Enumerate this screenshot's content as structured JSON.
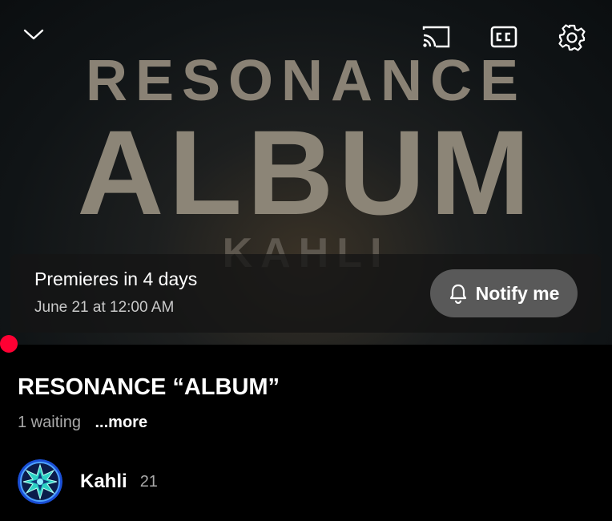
{
  "player": {
    "art_line1": "RESONANCE",
    "art_line2": "ALBUM",
    "art_line3": "KAHLI",
    "controls": [
      "chevron-down-icon",
      "cast-icon",
      "closed-captions-icon",
      "settings-gear-icon"
    ]
  },
  "premiere": {
    "title": "Premieres in 4 days",
    "date": "June 21 at 12:00 AM",
    "notify_label": "Notify me"
  },
  "video": {
    "title": "RESONANCE “ALBUM”",
    "waiting": "1 waiting",
    "more_label": "...more"
  },
  "channel": {
    "name": "Kahli",
    "count": "21"
  },
  "colors": {
    "accent_red": "#ff0033",
    "notify_button_bg": "#595959"
  }
}
